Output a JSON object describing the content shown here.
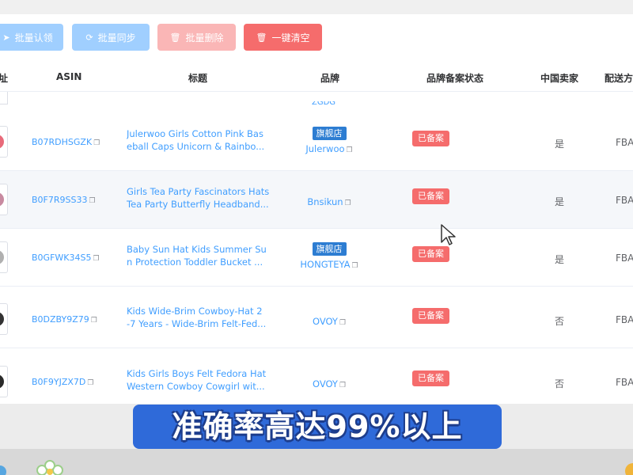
{
  "toolbar": {
    "claim_label": "批量认领",
    "sync_label": "批量同步",
    "delete_label": "批量删除",
    "clear_label": "一键清空"
  },
  "table": {
    "headers": {
      "url": "址",
      "asin": "ASIN",
      "title": "标题",
      "brand": "品牌",
      "brand_status": "品牌备案状态",
      "chinese_seller": "中国卖家",
      "shipping": "配送方"
    },
    "partial_row_brand": "ZGDG",
    "rows": [
      {
        "asin": "B07RDHSGZK",
        "title": "Julerwoo Girls Cotton Pink Bas\neball Caps Unicorn & Rainbo...",
        "flagship": "旗舰店",
        "brand": "Julerwoo",
        "status": "已备案",
        "chinese_seller": "是",
        "shipping": "FBA",
        "thumb_color": "#e86a7a"
      },
      {
        "asin": "B0F7R9SS33",
        "title": "Girls Tea Party Fascinators Hats\nTea Party Butterfly Headband...",
        "flagship": "",
        "brand": "Bnsikun",
        "status": "已备案",
        "chinese_seller": "是",
        "shipping": "FBA",
        "thumb_color": "#c88aa0"
      },
      {
        "asin": "B0GFWK34S5",
        "title": "Baby Sun Hat Kids Summer Su\nn Protection Toddler Bucket ...",
        "flagship": "旗舰店",
        "brand": "HONGTEYA",
        "status": "已备案",
        "chinese_seller": "是",
        "shipping": "FBA",
        "thumb_color": "#b0b0b0"
      },
      {
        "asin": "B0DZBY9Z79",
        "title": "Kids Wide-Brim Cowboy-Hat 2\n-7 Years - Wide-Brim Felt-Fed...",
        "flagship": "",
        "brand": "OVOY",
        "status": "已备案",
        "chinese_seller": "否",
        "shipping": "FBA",
        "thumb_color": "#333333"
      },
      {
        "asin": "B0F9YJZX7D",
        "title": "Kids Girls Boys Felt Fedora Hat\nWestern Cowboy Cowgirl wit...",
        "flagship": "",
        "brand": "OVOY",
        "status": "已备案",
        "chinese_seller": "否",
        "shipping": "FBA",
        "thumb_color": "#2a2a2a"
      }
    ]
  },
  "caption": "准确率高达99%以上",
  "colors": {
    "primary": "#409eff",
    "danger": "#f56c6c",
    "caption_bg": "#2f6ad9"
  }
}
